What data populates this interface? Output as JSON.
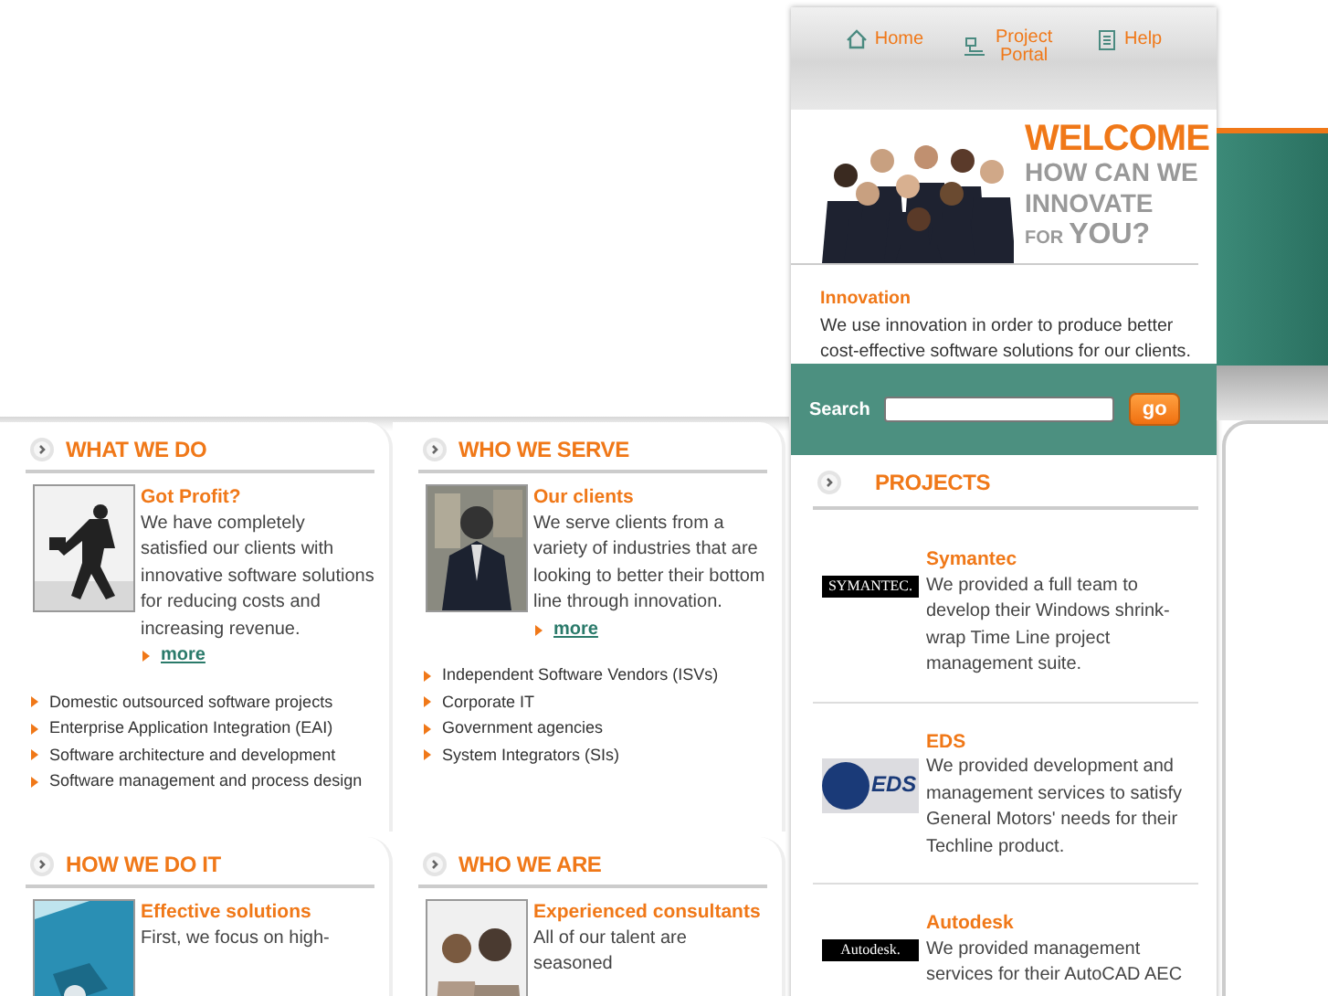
{
  "panels": [
    {
      "title": "WHAT WE DO",
      "heading": "Got Profit?",
      "text": "We have completely satisfied our clients with innovative software solutions for reducing costs and increasing revenue.",
      "more": "more",
      "bullets": [
        "Domestic outsourced software projects",
        "Enterprise Application Integration (EAI)",
        "Software architecture and development",
        "Software management and process design"
      ]
    },
    {
      "title": "WHO WE SERVE",
      "heading": "Our clients",
      "text": "We serve clients from a variety of industries that are looking to better their bottom line through innovation.",
      "more": "more",
      "bullets": [
        "Independent Software Vendors (ISVs)",
        "Corporate IT",
        "Government agencies",
        "System Integrators (SIs)"
      ]
    },
    {
      "title": "HOW WE DO IT",
      "heading": "Effective solutions",
      "text": "First, we focus on high-"
    },
    {
      "title": "WHO WE ARE",
      "heading": "Experienced consultants",
      "text": "All of our talent are seasoned"
    }
  ],
  "nav": [
    {
      "label": "Home"
    },
    {
      "label": "Project Portal"
    },
    {
      "label": "Help"
    }
  ],
  "welcome": {
    "title": "WELCOME",
    "lines": [
      "HOW CAN WE",
      "INNOVATE"
    ],
    "last_small": "FOR",
    "last_big": "YOU?"
  },
  "intro": {
    "title": "Innovation",
    "text": "We use innovation in order to produce better cost-effective software solutions for our clients."
  },
  "search": {
    "label": "Search",
    "button": "go"
  },
  "projects": {
    "title": "PROJECTS",
    "items": [
      {
        "logo": "SYMANTEC.",
        "name": "Symantec",
        "text": "We provided a full team to develop their Windows shrink-wrap Time Line project management suite."
      },
      {
        "logo": "EDS",
        "name": "EDS",
        "text": "We provided development and management services to satisfy General Motors' needs for their Techline product."
      },
      {
        "logo": "Autodesk.",
        "name": "Autodesk",
        "text": "We provided management services for their AutoCAD AEC"
      }
    ]
  }
}
